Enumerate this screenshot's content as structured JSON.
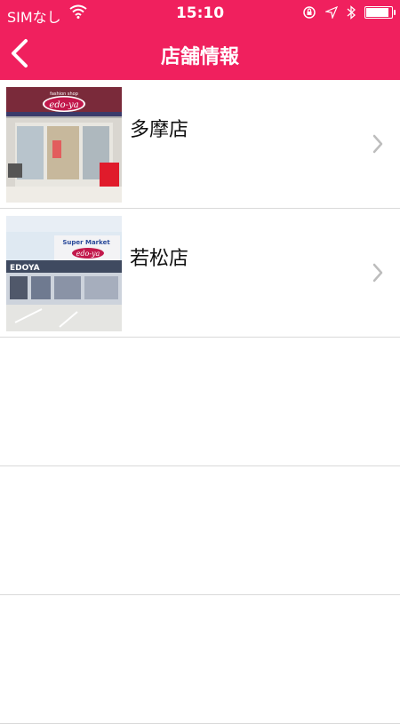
{
  "status": {
    "carrier": "SIMなし",
    "time": "15:10",
    "battery_level": 0.9
  },
  "header": {
    "title": "店舗情報",
    "back_icon": "chevron-left-icon"
  },
  "stores": [
    {
      "name": "多摩店",
      "sign_top": "fashion shop",
      "sign_logo": "edo-ya"
    },
    {
      "name": "若松店",
      "sign_top": "Super Market",
      "sign_logo": "edo-ya",
      "front_sign": "EDOYA"
    }
  ],
  "colors": {
    "accent": "#f0205e",
    "divider": "#d9d9d9",
    "chevron": "#bdbdbd"
  }
}
